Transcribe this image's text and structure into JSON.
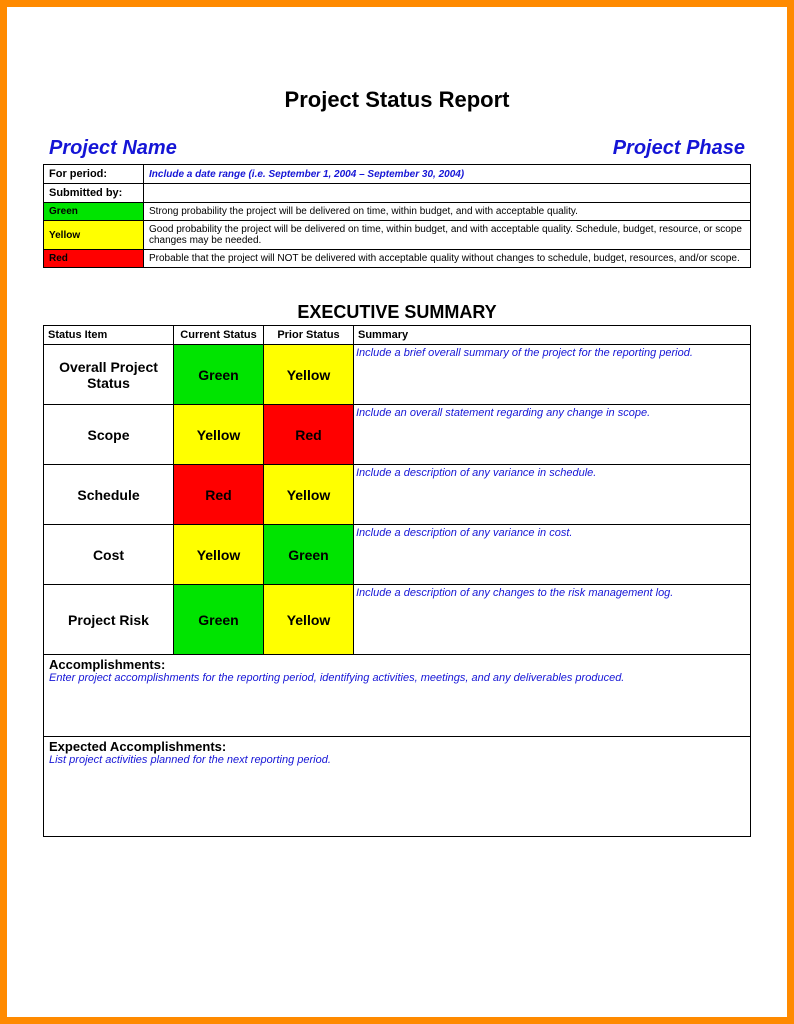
{
  "title": "Project Status Report",
  "header": {
    "left": "Project Name",
    "right": "Project Phase"
  },
  "meta": {
    "for_period_label": "For period:",
    "for_period_value": "Include a date range (i.e. September 1, 2004 – September 30, 2004)",
    "submitted_by_label": "Submitted by:",
    "submitted_by_value": "",
    "legend": [
      {
        "swatch": "Green",
        "class": "bg-green",
        "desc": "Strong probability the project will be delivered on time, within budget, and with acceptable quality."
      },
      {
        "swatch": "Yellow",
        "class": "bg-yellow",
        "desc": "Good probability the project will be delivered on time, within budget, and with acceptable quality. Schedule, budget, resource, or scope changes may be needed."
      },
      {
        "swatch": "Red",
        "class": "bg-red",
        "desc": "Probable that the project will NOT be delivered with acceptable quality without changes to schedule, budget, resources, and/or scope."
      }
    ]
  },
  "exec_title": "EXECUTIVE SUMMARY",
  "exec_headers": [
    "Status Item",
    "Current Status",
    "Prior Status",
    "Summary"
  ],
  "exec_rows": [
    {
      "item": "Overall Project Status",
      "current": "Green",
      "current_cls": "bg-green",
      "prior": "Yellow",
      "prior_cls": "bg-yellow",
      "summary": "Include a brief overall summary of the project for the reporting period."
    },
    {
      "item": "Scope",
      "current": "Yellow",
      "current_cls": "bg-yellow",
      "prior": "Red",
      "prior_cls": "bg-red",
      "summary": "Include an overall statement regarding any change in scope."
    },
    {
      "item": "Schedule",
      "current": "Red",
      "current_cls": "bg-red",
      "prior": "Yellow",
      "prior_cls": "bg-yellow",
      "summary": "Include a description of any variance in schedule."
    },
    {
      "item": "Cost",
      "current": "Yellow",
      "current_cls": "bg-yellow",
      "prior": "Green",
      "prior_cls": "bg-green",
      "summary": "Include a description of any variance in cost."
    },
    {
      "item": "Project Risk",
      "current": "Green",
      "current_cls": "bg-green",
      "prior": "Yellow",
      "prior_cls": "bg-yellow",
      "summary": "Include a description of any changes to the risk management log."
    }
  ],
  "accomplishments": {
    "heading": "Accomplishments:",
    "instr": "Enter project accomplishments for the reporting period, identifying activities, meetings, and any deliverables produced."
  },
  "expected": {
    "heading": "Expected Accomplishments:",
    "instr": "List project activities planned for the next reporting period."
  }
}
